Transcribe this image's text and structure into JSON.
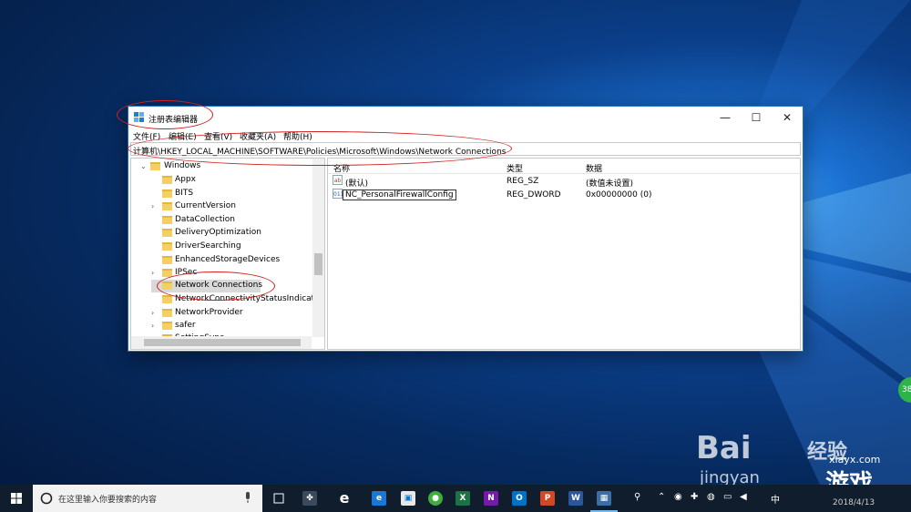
{
  "window": {
    "title": "注册表编辑器",
    "min": "—",
    "max": "☐",
    "close": "✕",
    "menu": [
      "文件(F)",
      "编辑(E)",
      "查看(V)",
      "收藏夹(A)",
      "帮助(H)"
    ],
    "address": "计算机\\HKEY_LOCAL_MACHINE\\SOFTWARE\\Policies\\Microsoft\\Windows\\Network Connections"
  },
  "tree": {
    "items": [
      {
        "label": "Windows",
        "expander": "⌄"
      },
      {
        "label": "Appx",
        "expander": ""
      },
      {
        "label": "BITS",
        "expander": ""
      },
      {
        "label": "CurrentVersion",
        "expander": "›"
      },
      {
        "label": "DataCollection",
        "expander": ""
      },
      {
        "label": "DeliveryOptimization",
        "expander": ""
      },
      {
        "label": "DriverSearching",
        "expander": ""
      },
      {
        "label": "EnhancedStorageDevices",
        "expander": ""
      },
      {
        "label": "IPSec",
        "expander": "›"
      },
      {
        "label": "Network Connections",
        "expander": "",
        "selected": true
      },
      {
        "label": "NetworkConnectivityStatusIndicator",
        "expander": ""
      },
      {
        "label": "NetworkProvider",
        "expander": "›"
      },
      {
        "label": "safer",
        "expander": "›"
      },
      {
        "label": "SettingSync",
        "expander": "›"
      }
    ]
  },
  "list": {
    "headers": {
      "name": "名称",
      "type": "类型",
      "data": "数据"
    },
    "rows": [
      {
        "icon": "ab",
        "name": "(默认)",
        "type": "REG_SZ",
        "data": "(数值未设置)"
      },
      {
        "icon": "011",
        "name": "NC_PersonalFirewallConfig",
        "type": "REG_DWORD",
        "data": "0x00000000 (0)"
      }
    ]
  },
  "taskbar": {
    "search_placeholder": "在这里输入你要搜索的内容",
    "date": "2018/4/13",
    "ime": "中"
  },
  "watermarks": {
    "baidu": "Bai",
    "baidu2": "经验",
    "jingyan": "jingyan",
    "game": "游戏",
    "site": "xlayx.com",
    "badge": "38"
  },
  "colors": {
    "accent": "#0078d7",
    "annotation": "#d0201c",
    "taskbar": "#0f1d2c"
  }
}
